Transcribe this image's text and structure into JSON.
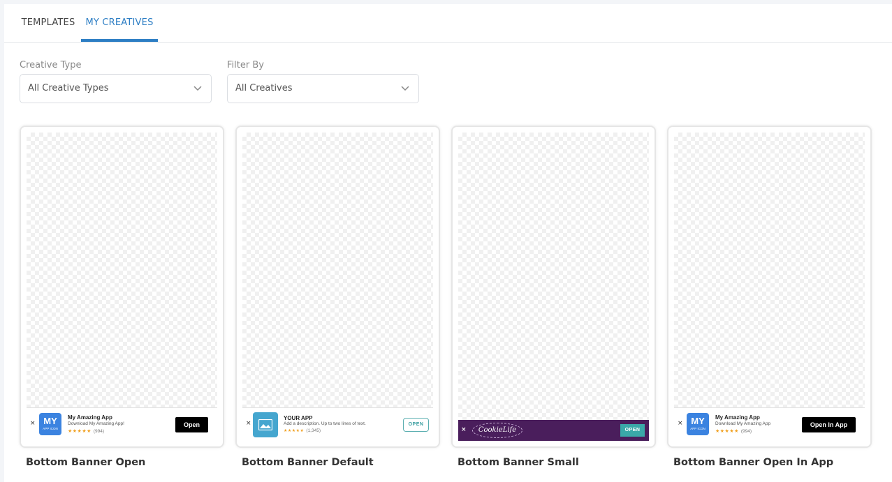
{
  "tabs": [
    {
      "label": "TEMPLATES",
      "active": false
    },
    {
      "label": "MY CREATIVES",
      "active": true
    }
  ],
  "filters": {
    "creative_type": {
      "label": "Creative Type",
      "value": "All Creative Types"
    },
    "filter_by": {
      "label": "Filter By",
      "value": "All Creatives"
    }
  },
  "accent_color": "#2d7ec4",
  "cards": [
    {
      "title": "Bottom Banner Open",
      "banner": {
        "close": "×",
        "icon_big": "MY",
        "icon_small": "APP ICON",
        "app_name": "My Amazing App",
        "description": "Download My Amazing App!",
        "stars": "★★★★★",
        "rating_count": "(994)",
        "button": "Open"
      }
    },
    {
      "title": "Bottom Banner Default",
      "banner": {
        "close": "×",
        "icon": "image-placeholder-icon",
        "app_name": "YOUR APP",
        "description": "Add a description. Up to two lines of text.",
        "stars": "★★★★★",
        "rating_count": "(1,345)",
        "button": "OPEN"
      }
    },
    {
      "title": "Bottom Banner Small",
      "banner": {
        "close": "×",
        "logo_text": "CookieLife",
        "button": "OPEN",
        "background_color": "#4a1e5c"
      }
    },
    {
      "title": "Bottom Banner Open In App",
      "banner": {
        "close": "×",
        "icon_big": "MY",
        "icon_small": "APP ICON",
        "app_name": "My Amazing App",
        "description": "Download My Amazing App",
        "stars": "★★★★★",
        "rating_count": "(994)",
        "button": "Open In App"
      }
    }
  ]
}
